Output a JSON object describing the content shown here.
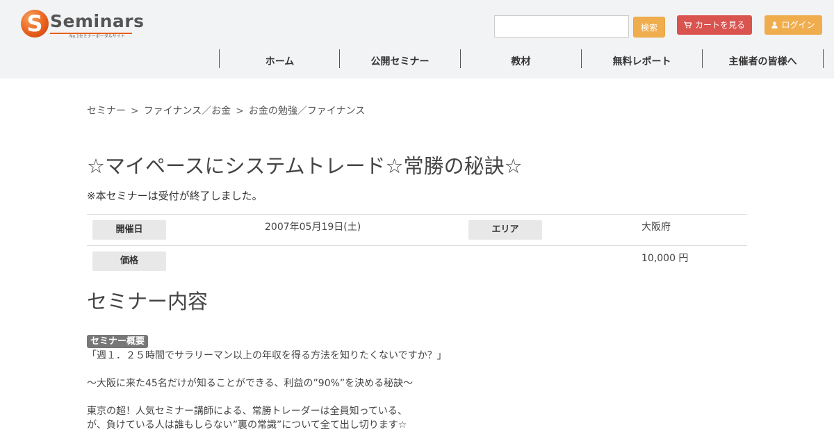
{
  "header": {
    "logo": {
      "mark": "S",
      "wordmark": "Seminars",
      "tagline": "No.1セミナーポータルサイト"
    },
    "search": {
      "value": "",
      "placeholder": "",
      "button_label": "検索"
    },
    "cart": {
      "icon": "shopping-cart-icon",
      "label": "カートを見る"
    },
    "login": {
      "icon": "user-icon",
      "label": "ログイン"
    },
    "nav": [
      "ホーム",
      "公開セミナー",
      "教材",
      "無料レポート",
      "主催者の皆様へ"
    ]
  },
  "breadcrumb": {
    "items": [
      "セミナー",
      "ファイナンス／お金",
      "お金の勉強／ファイナンス"
    ],
    "separator": ">"
  },
  "seminar": {
    "title": "☆マイペースにシステムトレード☆常勝の秘訣☆",
    "notice": "※本セミナーは受付が終了しました。",
    "info": {
      "date_label": "開催日",
      "date_value": "2007年05月19日(土)",
      "area_label": "エリア",
      "area_value": "大阪府",
      "price_label": "価格",
      "price_value": "10,000 円"
    }
  },
  "content": {
    "heading": "セミナー内容",
    "badge": "セミナー概要",
    "paragraphs": [
      [
        "「週１．２５時間でサラリーマン以上の年収を得る方法を知りたくないですか？」"
      ],
      [
        "〜大阪に来た45名だけが知ることができる、利益の”90%”を決める秘訣〜"
      ],
      [
        "東京の超！人気セミナー講師による、常勝トレーダーは全員知っている、",
        "が、負けている人は誰もしらない”裏の常識”について全て出し切ります☆"
      ]
    ]
  },
  "colors": {
    "header_bg": "#f2f3f5",
    "brand_orange": "#e8601c",
    "search_button": "#f0ad4e",
    "cart_button": "#d9534f",
    "login_button": "#f0ad4e",
    "badge_bg": "#777777"
  }
}
